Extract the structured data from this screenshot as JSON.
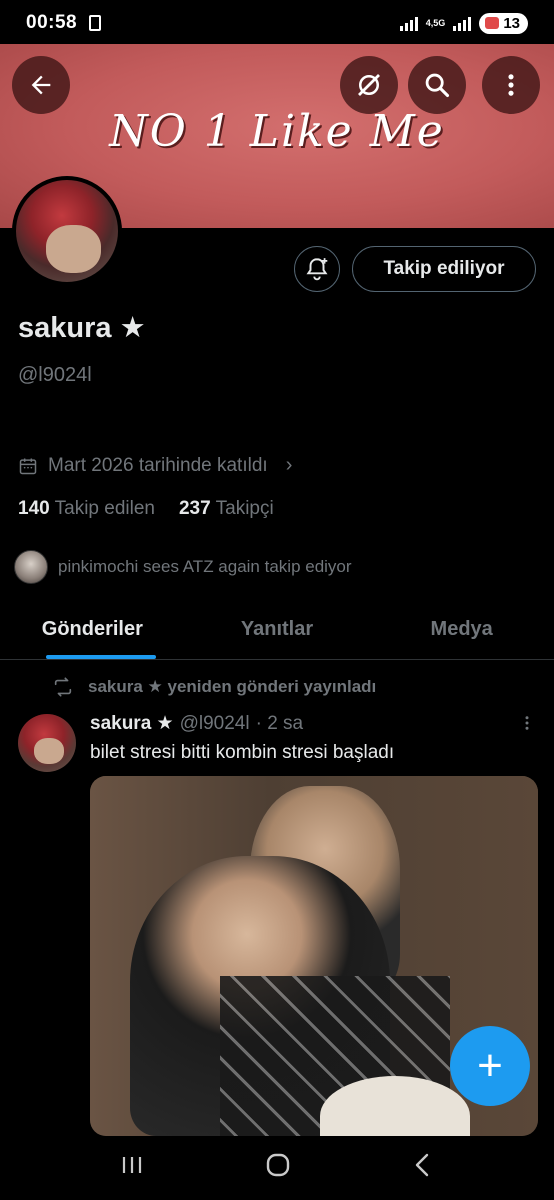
{
  "status_bar": {
    "time": "00:58",
    "network": "4,5G",
    "battery": "13"
  },
  "banner": {
    "text": "NO 1 Like Me",
    "back_icon": "arrow-left-icon",
    "translate_icon": "grok-icon",
    "search_icon": "search-icon",
    "more_icon": "more-vertical-icon"
  },
  "profile": {
    "notify_icon": "bell-plus-icon",
    "follow_button": "Takip ediliyor",
    "display_name": "sakura ★",
    "handle": "@l9024l",
    "joined": "Mart 2026 tarihinde katıldı",
    "following_count": "140",
    "following_label": "Takip edilen",
    "followers_count": "237",
    "followers_label": "Takipçi",
    "followed_by": "pinkimochi sees ATZ again takip ediyor"
  },
  "tabs": [
    {
      "label": "Gönderiler",
      "active": true
    },
    {
      "label": "Yanıtlar",
      "active": false
    },
    {
      "label": "Medya",
      "active": false
    }
  ],
  "post": {
    "repost_text": "sakura ★ yeniden gönderi yayınladı",
    "author_name": "sakura ★",
    "author_handle": "@l9024l",
    "time": "· 2 sa",
    "text": "bilet stresi bitti kombin stresi başladı"
  },
  "fab_label": "+",
  "colors": {
    "accent": "#1d9bf0",
    "banner": "#c25b5b",
    "muted": "#71767b"
  }
}
